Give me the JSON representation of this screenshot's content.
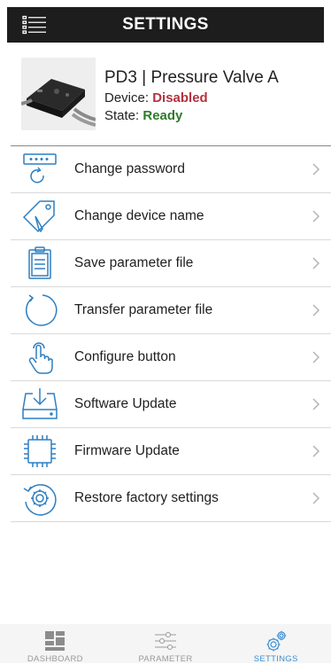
{
  "header": {
    "title": "SETTINGS"
  },
  "device": {
    "name": "PD3 | Pressure Valve A",
    "device_label": "Device:",
    "device_value": "Disabled",
    "state_label": "State:",
    "state_value": "Ready"
  },
  "menu": [
    {
      "label": "Change password",
      "icon": "password-keypad-icon"
    },
    {
      "label": "Change device name",
      "icon": "tag-pen-icon"
    },
    {
      "label": "Save parameter file",
      "icon": "clipboard-icon"
    },
    {
      "label": "Transfer parameter file",
      "icon": "circular-arrow-icon"
    },
    {
      "label": "Configure button",
      "icon": "finger-press-icon"
    },
    {
      "label": "Software Update",
      "icon": "download-tray-icon"
    },
    {
      "label": "Firmware Update",
      "icon": "chip-icon"
    },
    {
      "label": "Restore factory settings",
      "icon": "gear-reset-icon"
    }
  ],
  "nav": {
    "tabs": [
      {
        "label": "DASHBOARD",
        "icon": "dashboard-grid-icon",
        "active": false
      },
      {
        "label": "PARAMETER",
        "icon": "sliders-icon",
        "active": false
      },
      {
        "label": "SETTINGS",
        "icon": "gears-icon",
        "active": true
      }
    ]
  },
  "colors": {
    "accent": "#3a8fd4",
    "disabled": "#b3323d",
    "ready": "#2f7a2a",
    "header_bg": "#1d1d1d"
  }
}
